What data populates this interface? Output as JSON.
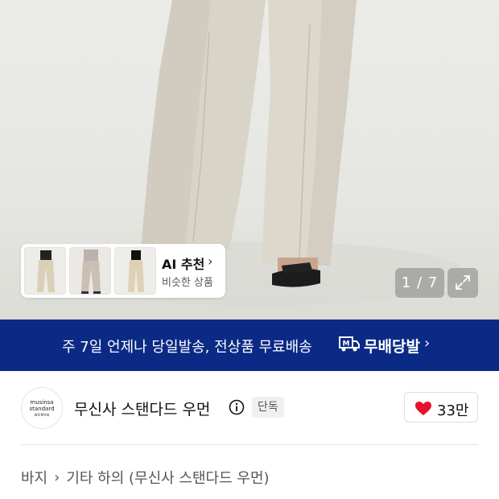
{
  "gallery": {
    "counter": "1 / 7",
    "ai_recommend": {
      "title": "AI 추천",
      "subtitle": "비슷한 상품"
    }
  },
  "banner": {
    "text": "주 7일 언제나 당일발송, 전상품 무료배송",
    "brand": "무배당발",
    "logo_letter": "M",
    "background": "#0b2a86"
  },
  "brand": {
    "logo_lines": [
      "musinsa",
      "standard",
      "WOMAN"
    ],
    "name": "무신사 스탠다드 우먼",
    "badge": "단독",
    "likes": "33만",
    "heart_color": "#e8112d"
  },
  "breadcrumb": {
    "items": [
      "바지",
      "기타 하의 (무신사 스탠다드 우먼)"
    ]
  }
}
